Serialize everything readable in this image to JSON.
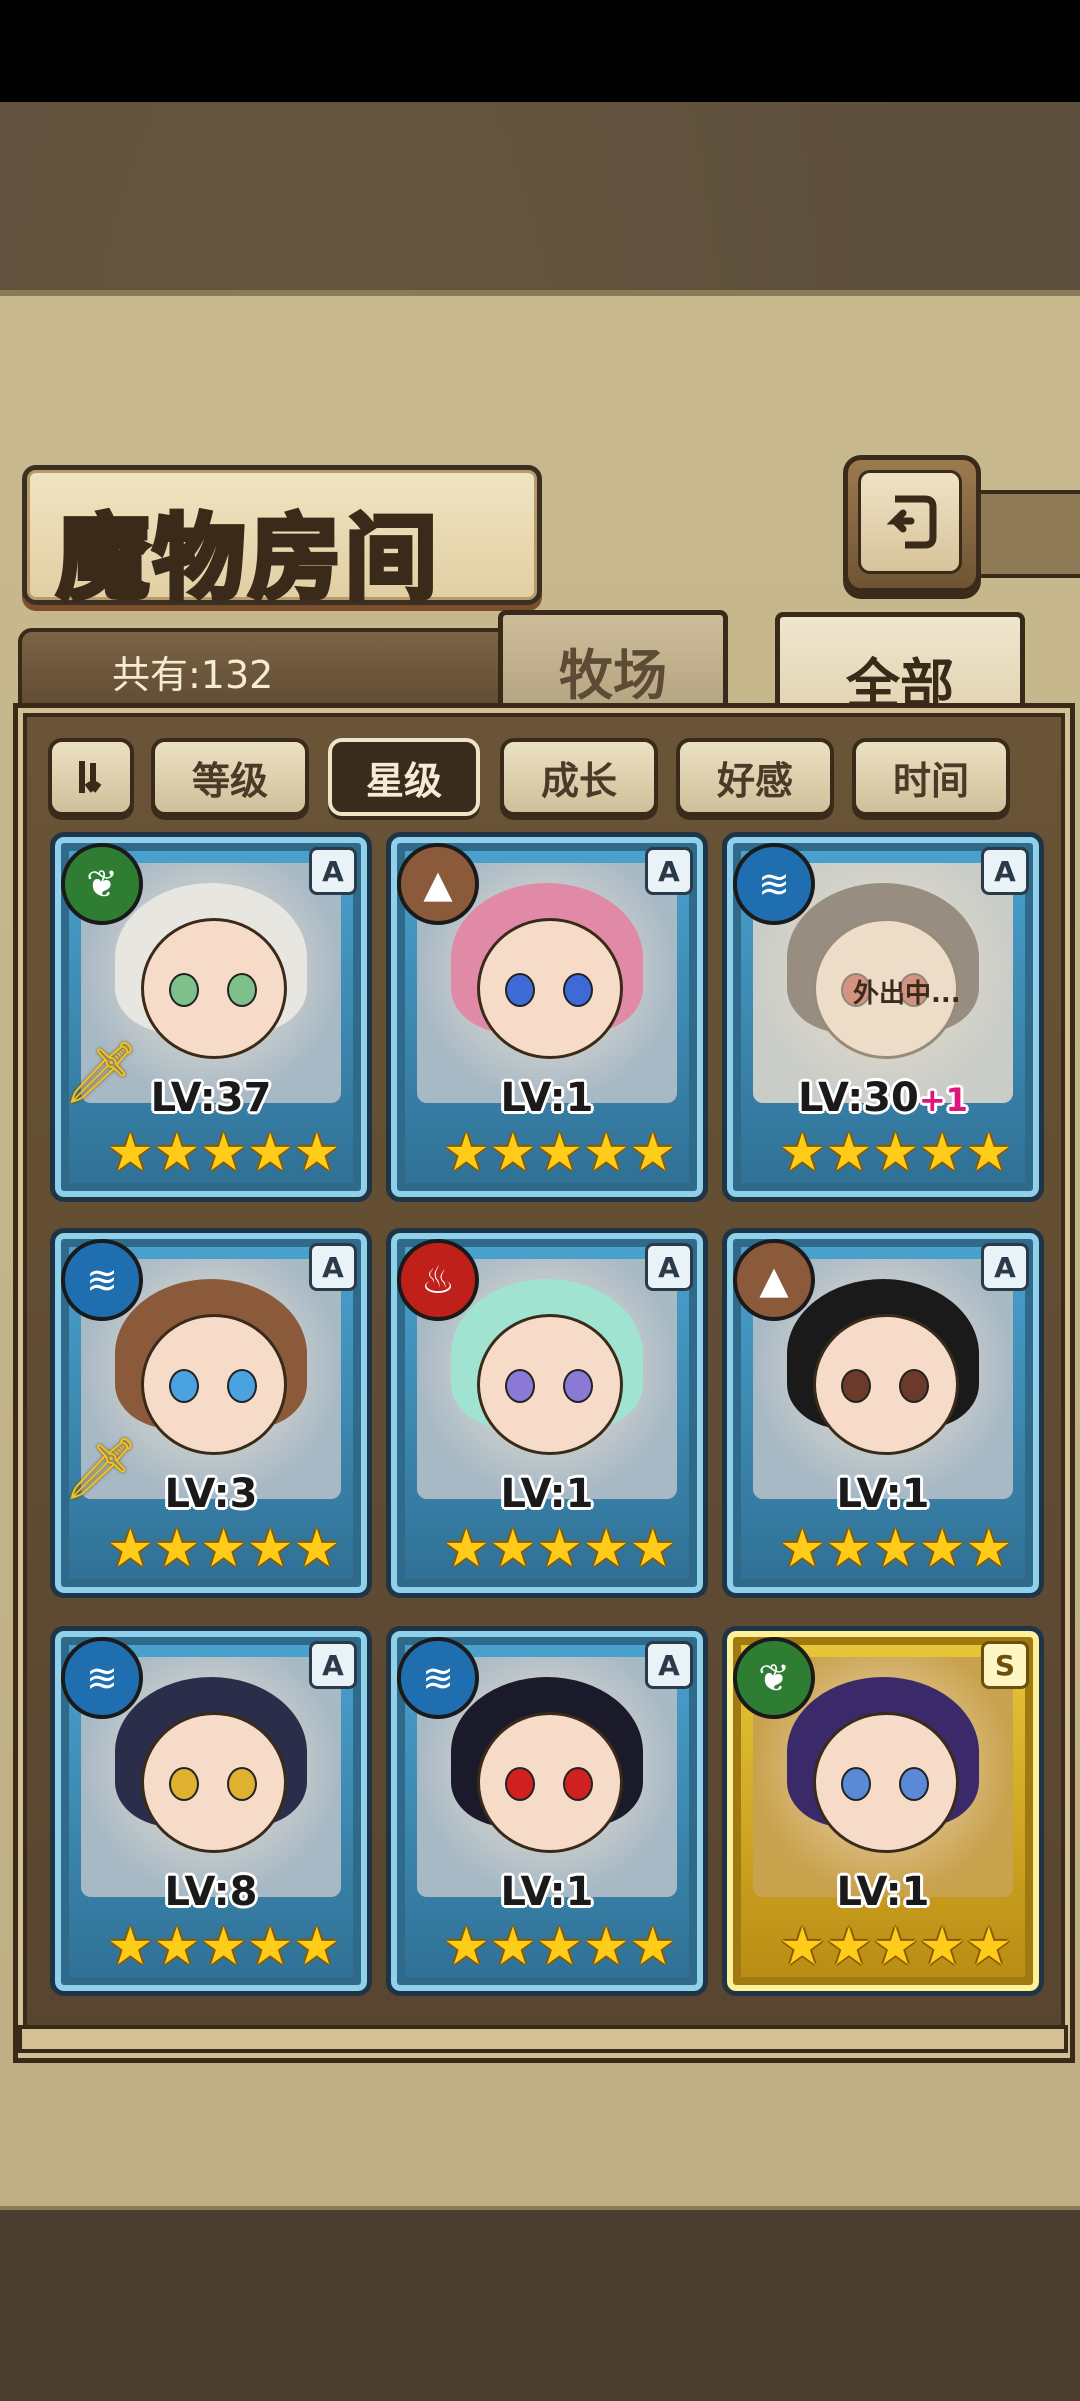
{
  "title": "魔物房间",
  "count_label": "共有:132",
  "tabs": {
    "ranch": "牧场",
    "all": "全部"
  },
  "filters": [
    {
      "label": "等级",
      "active": false
    },
    {
      "label": "星级",
      "active": true
    },
    {
      "label": "成长",
      "active": false
    },
    {
      "label": "好感",
      "active": false
    },
    {
      "label": "时间",
      "active": false
    }
  ],
  "monsters": [
    {
      "level": "LV:37",
      "plus": "",
      "rank": "A",
      "attr": "grass",
      "attr_color": "#2f7d32",
      "stars": 5,
      "equip": true,
      "away": "",
      "hair": "#e8e6e0",
      "eyes": "#7fbf8a",
      "frame": "blue"
    },
    {
      "level": "LV:1",
      "plus": "",
      "rank": "A",
      "attr": "earth",
      "attr_color": "#8a5a3a",
      "stars": 5,
      "equip": false,
      "away": "",
      "hair": "#e08aa8",
      "eyes": "#3d6ad6",
      "frame": "blue"
    },
    {
      "level": "LV:30",
      "plus": "+1",
      "rank": "A",
      "attr": "water",
      "attr_color": "#1f6fb0",
      "stars": 5,
      "equip": false,
      "away": "外出中...",
      "hair": "#3a2e2a",
      "eyes": "#c0392b",
      "frame": "blue"
    },
    {
      "level": "LV:3",
      "plus": "",
      "rank": "A",
      "attr": "water",
      "attr_color": "#1f6fb0",
      "stars": 5,
      "equip": true,
      "away": "",
      "hair": "#8a5a3a",
      "eyes": "#4aa3e0",
      "frame": "blue"
    },
    {
      "level": "LV:1",
      "plus": "",
      "rank": "A",
      "attr": "fire",
      "attr_color": "#c0201a",
      "stars": 5,
      "equip": false,
      "away": "",
      "hair": "#9fe3d0",
      "eyes": "#8a7ad6",
      "frame": "blue"
    },
    {
      "level": "LV:1",
      "plus": "",
      "rank": "A",
      "attr": "earth",
      "attr_color": "#8a5a3a",
      "stars": 5,
      "equip": false,
      "away": "",
      "hair": "#1a1a1a",
      "eyes": "#6b3a2a",
      "frame": "blue"
    },
    {
      "level": "LV:8",
      "plus": "",
      "rank": "A",
      "attr": "water",
      "attr_color": "#1f6fb0",
      "stars": 5,
      "equip": false,
      "away": "",
      "hair": "#2a2e4a",
      "eyes": "#e0b030",
      "frame": "blue"
    },
    {
      "level": "LV:1",
      "plus": "",
      "rank": "A",
      "attr": "water",
      "attr_color": "#1f6fb0",
      "stars": 5,
      "equip": false,
      "away": "",
      "hair": "#1a1a2a",
      "eyes": "#d02020",
      "frame": "blue"
    },
    {
      "level": "LV:1",
      "plus": "",
      "rank": "S",
      "attr": "grass",
      "attr_color": "#2f7d32",
      "stars": 5,
      "equip": false,
      "away": "",
      "hair": "#3a2a6a",
      "eyes": "#5a8ad6",
      "frame": "gold"
    }
  ]
}
